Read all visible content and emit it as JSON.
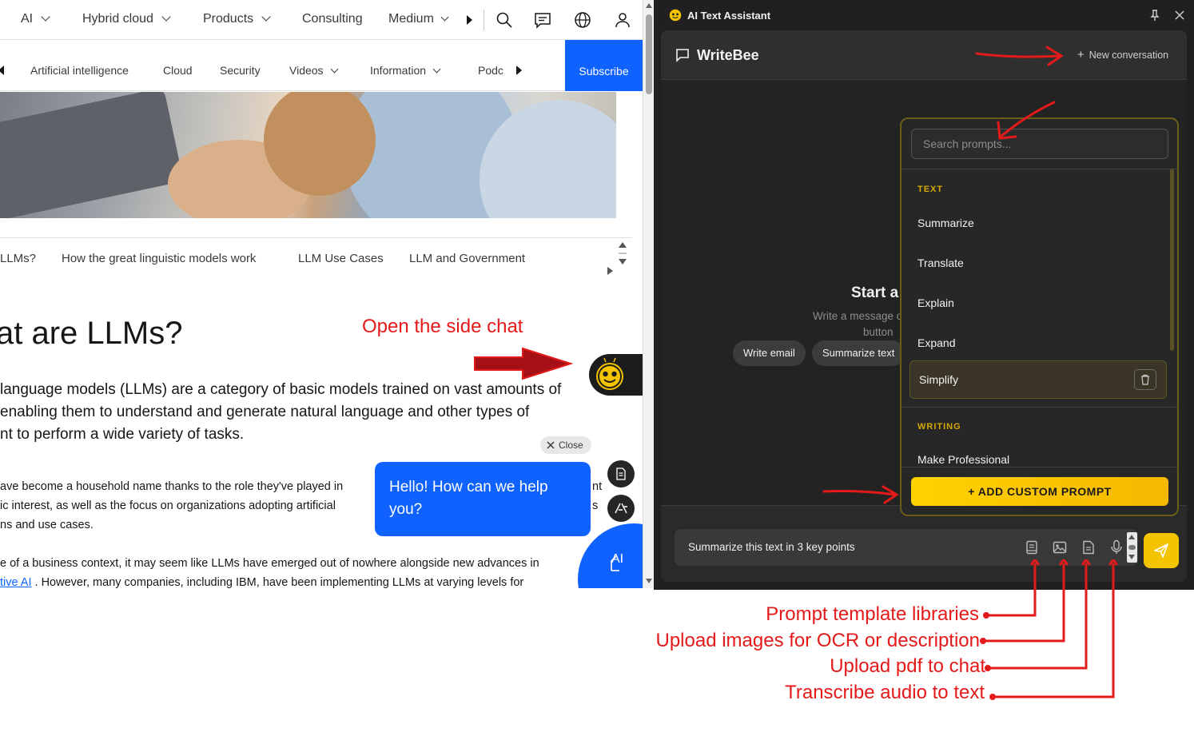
{
  "top_nav": {
    "items": [
      "AI",
      "Hybrid cloud",
      "Products",
      "Consulting",
      "Medium"
    ]
  },
  "sub_nav": {
    "items": [
      "Artificial intelligence",
      "Cloud",
      "Security",
      "Videos",
      "Information",
      "Podc"
    ],
    "subscribe": "Subscribe"
  },
  "toc": {
    "items": [
      "LLMs?",
      "How the great linguistic models work",
      "LLM Use Cases",
      "LLM and Government"
    ]
  },
  "article": {
    "title": "at are LLMs?",
    "lead": [
      "language models (LLMs) are a category of basic models trained on vast amounts of",
      "enabling them to understand and generate natural language and other types of",
      "nt to perform a wide variety of tasks."
    ],
    "body": [
      "ave become a household name thanks to the role they've played in",
      "ic interest, as well as the focus on organizations adopting artificial",
      "ns and use cases.",
      "e of a business context, it may seem like LLMs have emerged out of nowhere alongside new advances in",
      "tive AI",
      ". However, many companies, including IBM, have been implementing LLMs at varying levels for"
    ],
    "body_right_fragments": [
      "nt",
      "s"
    ]
  },
  "widget": {
    "close": "Close",
    "greeting": "Hello! How can we help\nyou?",
    "fab_label": "AI"
  },
  "panel": {
    "window_title": "AI Text Assistant",
    "app_name": "WriteBee",
    "new_conversation": "New conversation",
    "empty_title": "Start a",
    "empty_sub_1": "Write a message o",
    "empty_sub_2": "button",
    "chips": [
      "Write email",
      "Summarize text"
    ],
    "composer_value": "Summarize this text in 3 key points",
    "prompt_dropdown": {
      "search_placeholder": "Search prompts...",
      "categories": [
        {
          "name": "TEXT",
          "items": [
            "Summarize",
            "Translate",
            "Explain",
            "Expand",
            "Simplify"
          ]
        },
        {
          "name": "WRITING",
          "items": [
            "Make Professional"
          ]
        }
      ],
      "selected_item": "Simplify",
      "add_button": "+ ADD CUSTOM PROMPT"
    }
  },
  "annotations": {
    "open_side_chat": "Open the side chat",
    "prompt_libraries": "Prompt template libraries",
    "upload_images": "Upload images for OCR or description",
    "upload_pdf": "Upload pdf to chat",
    "transcribe_audio": "Transcribe audio to text"
  },
  "colors": {
    "ibm_blue": "#0f62fe",
    "panel_bg": "#202020",
    "accent_yellow": "#f5c400",
    "annotation_red": "#e41a1a"
  }
}
